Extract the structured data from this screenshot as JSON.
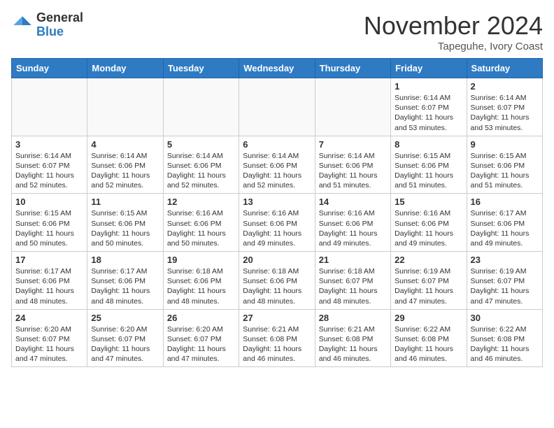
{
  "header": {
    "logo_general": "General",
    "logo_blue": "Blue",
    "month_title": "November 2024",
    "location": "Tapeguhe, Ivory Coast"
  },
  "weekdays": [
    "Sunday",
    "Monday",
    "Tuesday",
    "Wednesday",
    "Thursday",
    "Friday",
    "Saturday"
  ],
  "weeks": [
    [
      {
        "day": "",
        "info": ""
      },
      {
        "day": "",
        "info": ""
      },
      {
        "day": "",
        "info": ""
      },
      {
        "day": "",
        "info": ""
      },
      {
        "day": "",
        "info": ""
      },
      {
        "day": "1",
        "info": "Sunrise: 6:14 AM\nSunset: 6:07 PM\nDaylight: 11 hours\nand 53 minutes."
      },
      {
        "day": "2",
        "info": "Sunrise: 6:14 AM\nSunset: 6:07 PM\nDaylight: 11 hours\nand 53 minutes."
      }
    ],
    [
      {
        "day": "3",
        "info": "Sunrise: 6:14 AM\nSunset: 6:07 PM\nDaylight: 11 hours\nand 52 minutes."
      },
      {
        "day": "4",
        "info": "Sunrise: 6:14 AM\nSunset: 6:06 PM\nDaylight: 11 hours\nand 52 minutes."
      },
      {
        "day": "5",
        "info": "Sunrise: 6:14 AM\nSunset: 6:06 PM\nDaylight: 11 hours\nand 52 minutes."
      },
      {
        "day": "6",
        "info": "Sunrise: 6:14 AM\nSunset: 6:06 PM\nDaylight: 11 hours\nand 52 minutes."
      },
      {
        "day": "7",
        "info": "Sunrise: 6:14 AM\nSunset: 6:06 PM\nDaylight: 11 hours\nand 51 minutes."
      },
      {
        "day": "8",
        "info": "Sunrise: 6:15 AM\nSunset: 6:06 PM\nDaylight: 11 hours\nand 51 minutes."
      },
      {
        "day": "9",
        "info": "Sunrise: 6:15 AM\nSunset: 6:06 PM\nDaylight: 11 hours\nand 51 minutes."
      }
    ],
    [
      {
        "day": "10",
        "info": "Sunrise: 6:15 AM\nSunset: 6:06 PM\nDaylight: 11 hours\nand 50 minutes."
      },
      {
        "day": "11",
        "info": "Sunrise: 6:15 AM\nSunset: 6:06 PM\nDaylight: 11 hours\nand 50 minutes."
      },
      {
        "day": "12",
        "info": "Sunrise: 6:16 AM\nSunset: 6:06 PM\nDaylight: 11 hours\nand 50 minutes."
      },
      {
        "day": "13",
        "info": "Sunrise: 6:16 AM\nSunset: 6:06 PM\nDaylight: 11 hours\nand 49 minutes."
      },
      {
        "day": "14",
        "info": "Sunrise: 6:16 AM\nSunset: 6:06 PM\nDaylight: 11 hours\nand 49 minutes."
      },
      {
        "day": "15",
        "info": "Sunrise: 6:16 AM\nSunset: 6:06 PM\nDaylight: 11 hours\nand 49 minutes."
      },
      {
        "day": "16",
        "info": "Sunrise: 6:17 AM\nSunset: 6:06 PM\nDaylight: 11 hours\nand 49 minutes."
      }
    ],
    [
      {
        "day": "17",
        "info": "Sunrise: 6:17 AM\nSunset: 6:06 PM\nDaylight: 11 hours\nand 48 minutes."
      },
      {
        "day": "18",
        "info": "Sunrise: 6:17 AM\nSunset: 6:06 PM\nDaylight: 11 hours\nand 48 minutes."
      },
      {
        "day": "19",
        "info": "Sunrise: 6:18 AM\nSunset: 6:06 PM\nDaylight: 11 hours\nand 48 minutes."
      },
      {
        "day": "20",
        "info": "Sunrise: 6:18 AM\nSunset: 6:06 PM\nDaylight: 11 hours\nand 48 minutes."
      },
      {
        "day": "21",
        "info": "Sunrise: 6:18 AM\nSunset: 6:07 PM\nDaylight: 11 hours\nand 48 minutes."
      },
      {
        "day": "22",
        "info": "Sunrise: 6:19 AM\nSunset: 6:07 PM\nDaylight: 11 hours\nand 47 minutes."
      },
      {
        "day": "23",
        "info": "Sunrise: 6:19 AM\nSunset: 6:07 PM\nDaylight: 11 hours\nand 47 minutes."
      }
    ],
    [
      {
        "day": "24",
        "info": "Sunrise: 6:20 AM\nSunset: 6:07 PM\nDaylight: 11 hours\nand 47 minutes."
      },
      {
        "day": "25",
        "info": "Sunrise: 6:20 AM\nSunset: 6:07 PM\nDaylight: 11 hours\nand 47 minutes."
      },
      {
        "day": "26",
        "info": "Sunrise: 6:20 AM\nSunset: 6:07 PM\nDaylight: 11 hours\nand 47 minutes."
      },
      {
        "day": "27",
        "info": "Sunrise: 6:21 AM\nSunset: 6:08 PM\nDaylight: 11 hours\nand 46 minutes."
      },
      {
        "day": "28",
        "info": "Sunrise: 6:21 AM\nSunset: 6:08 PM\nDaylight: 11 hours\nand 46 minutes."
      },
      {
        "day": "29",
        "info": "Sunrise: 6:22 AM\nSunset: 6:08 PM\nDaylight: 11 hours\nand 46 minutes."
      },
      {
        "day": "30",
        "info": "Sunrise: 6:22 AM\nSunset: 6:08 PM\nDaylight: 11 hours\nand 46 minutes."
      }
    ]
  ]
}
